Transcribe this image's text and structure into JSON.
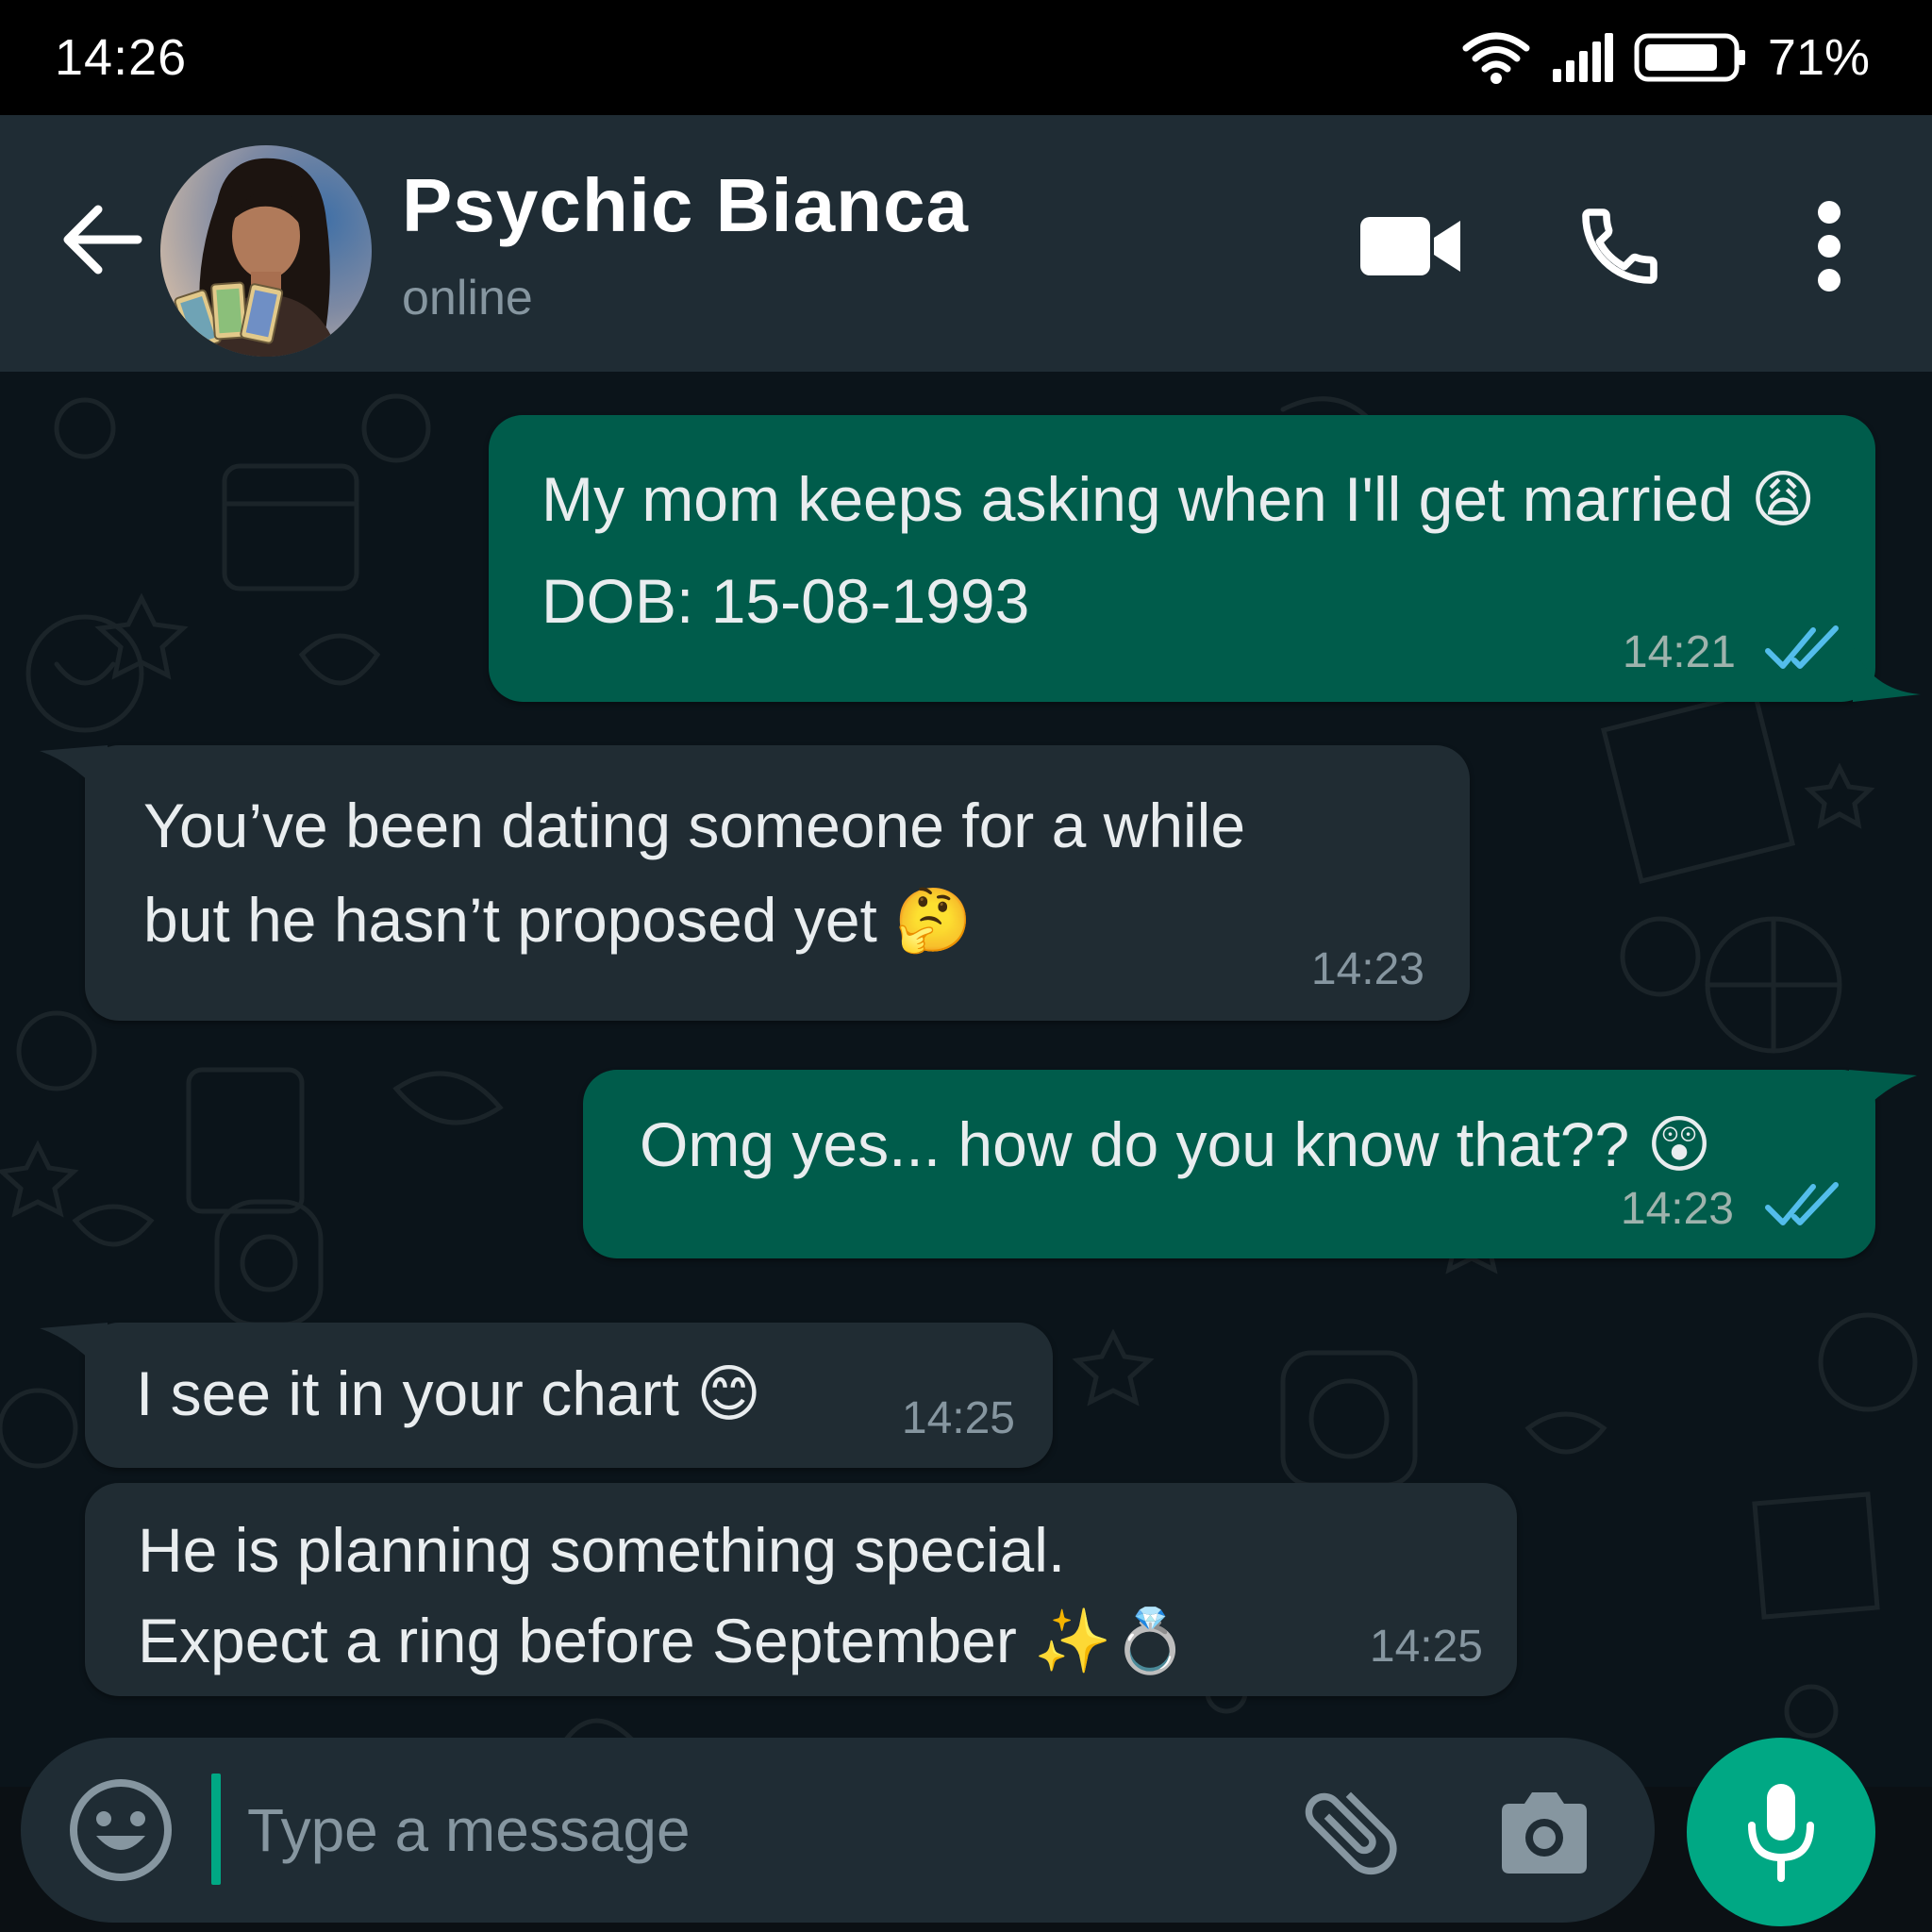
{
  "status_bar": {
    "time": "14:26",
    "battery": "71%"
  },
  "header": {
    "contact_name": "Psychic Bianca",
    "contact_status": "online"
  },
  "messages": [
    {
      "direction": "outgoing",
      "lines": [
        "My mom keeps asking when I'll get married 😩",
        "DOB: 15-08-1993"
      ],
      "time": "14:21",
      "read": true
    },
    {
      "direction": "incoming",
      "lines": [
        "You’ve been dating someone for a while",
        "but he hasn’t proposed yet 🤔"
      ],
      "time": "14:23"
    },
    {
      "direction": "outgoing",
      "lines": [
        "Omg yes... how do you know that?? 😲"
      ],
      "time": "14:23",
      "read": true
    },
    {
      "direction": "incoming",
      "lines": [
        "I see it in your chart 😊"
      ],
      "time": "14:25"
    },
    {
      "direction": "incoming",
      "lines": [
        "He is planning something special.",
        "Expect a ring before September ✨💍"
      ],
      "time": "14:25"
    }
  ],
  "composer": {
    "placeholder": "Type a message"
  },
  "colors": {
    "outgoing_bubble": "#005c4b",
    "incoming_bubble": "#202c33",
    "accent": "#00a884",
    "read_ticks": "#53bdeb"
  }
}
